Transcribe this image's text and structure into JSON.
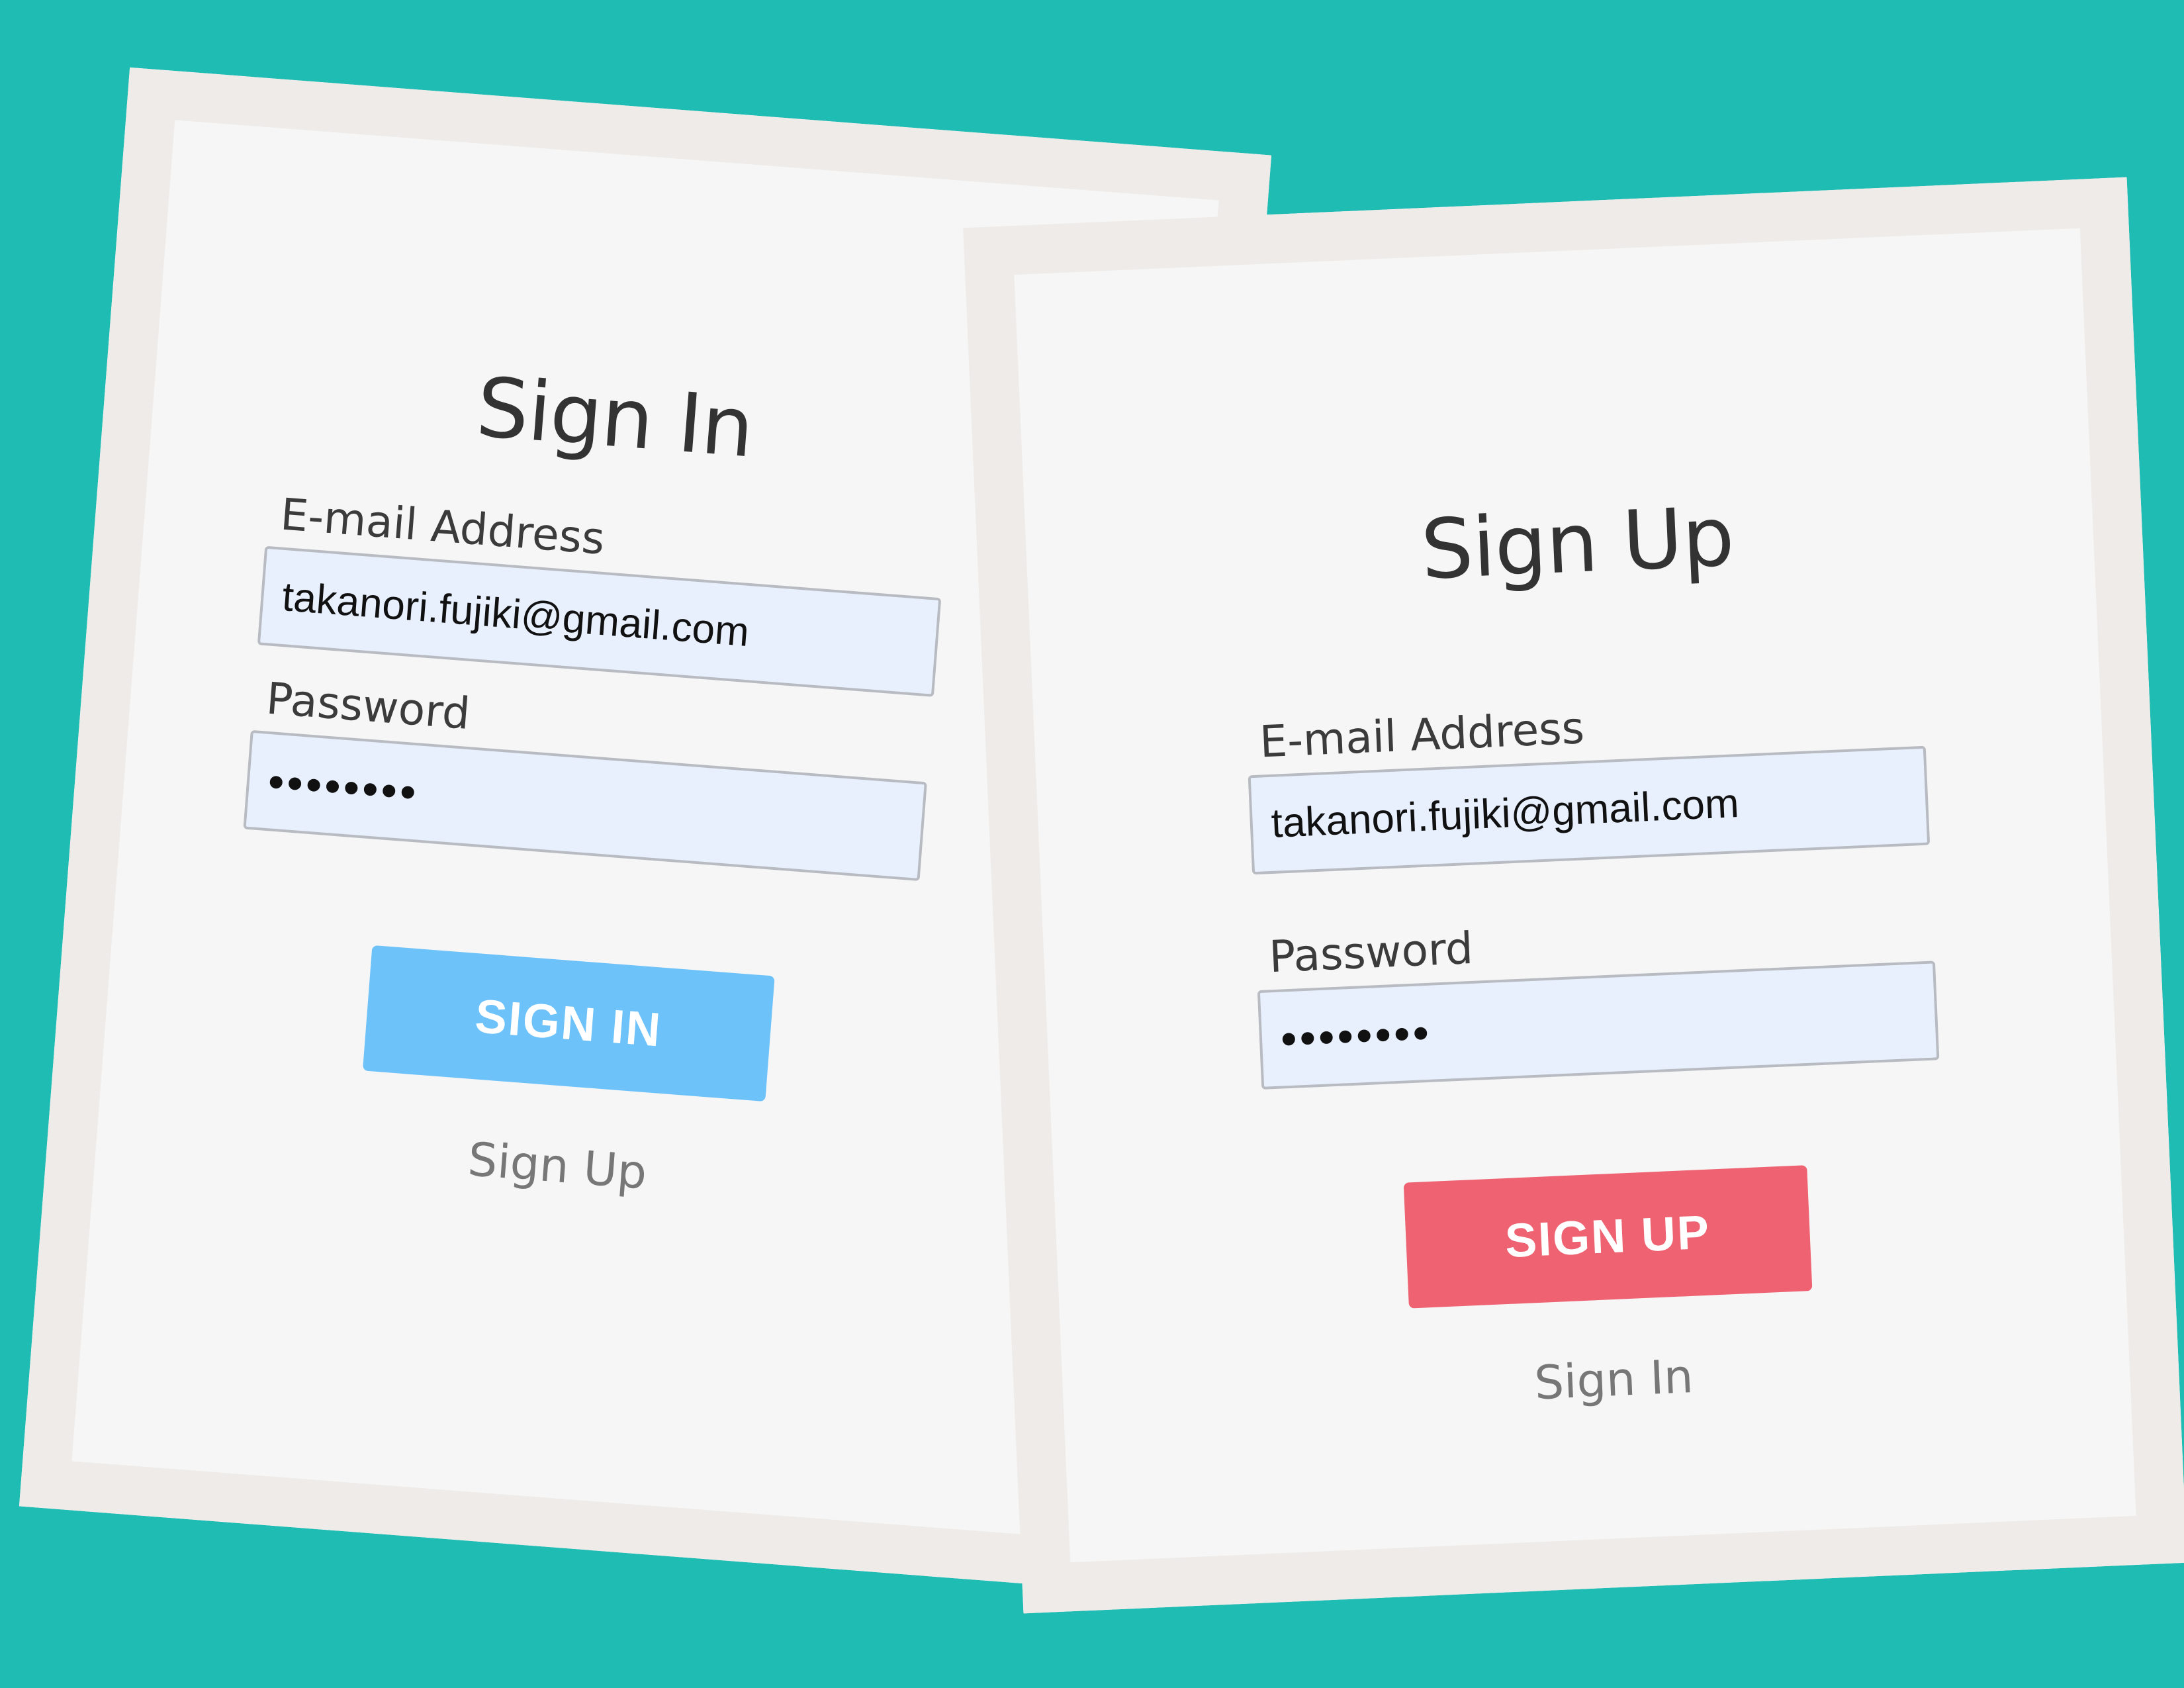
{
  "colors": {
    "background": "#1fbcb4",
    "card_border": "#eeebe8",
    "card_face": "#f6f6f6",
    "input_fill": "#e8f0fe",
    "signin_button": "#6ec2fa",
    "signup_button": "#ee6272"
  },
  "signin": {
    "title": "Sign In",
    "email_label": "E-mail Address",
    "email_value": "takanori.fujiki@gmail.com",
    "password_label": "Password",
    "password_value": "••••••••",
    "button_label": "SIGN IN",
    "switch_link": "Sign Up"
  },
  "signup": {
    "title": "Sign Up",
    "email_label": "E-mail Address",
    "email_value": "takanori.fujiki@gmail.com",
    "password_label": "Password",
    "password_value": "••••••••",
    "button_label": "SIGN UP",
    "switch_link": "Sign In"
  }
}
